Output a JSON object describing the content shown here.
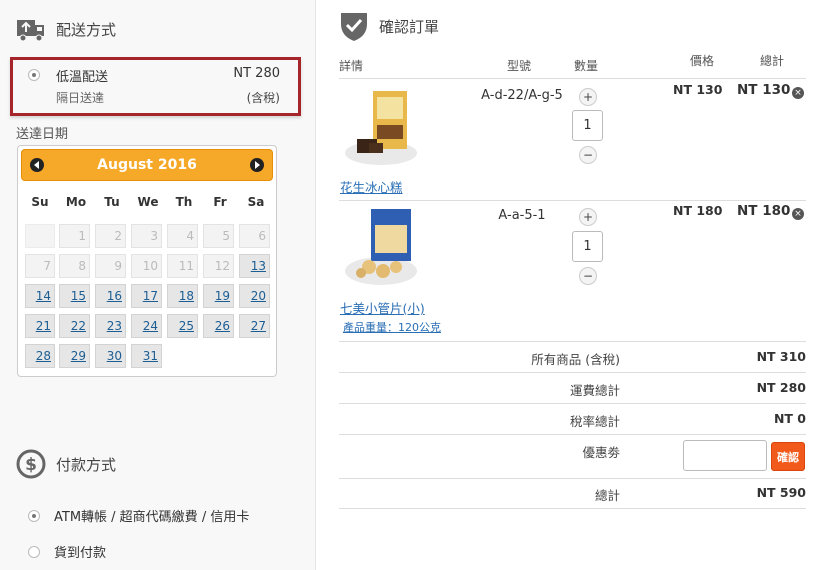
{
  "shipping": {
    "section_title": "配送方式",
    "option": {
      "name": "低溫配送",
      "price": "NT 280",
      "desc": "隔日送達",
      "tax": "(含稅)"
    },
    "date_label": "送達日期"
  },
  "calendar": {
    "month_title": "August 2016",
    "days_of_week": [
      "Su",
      "Mo",
      "Tu",
      "We",
      "Th",
      "Fr",
      "Sa"
    ],
    "rows": [
      [
        "",
        "1",
        "2",
        "3",
        "4",
        "5",
        "6"
      ],
      [
        "7",
        "8",
        "9",
        "10",
        "11",
        "12",
        "13"
      ],
      [
        "14",
        "15",
        "16",
        "17",
        "18",
        "19",
        "20"
      ],
      [
        "21",
        "22",
        "23",
        "24",
        "25",
        "26",
        "27"
      ],
      [
        "28",
        "29",
        "30",
        "31"
      ]
    ]
  },
  "payment": {
    "section_title": "付款方式",
    "options": [
      {
        "label": "ATM轉帳 / 超商代碼繳費 / 信用卡",
        "selected": true
      },
      {
        "label": "貨到付款",
        "selected": false
      }
    ]
  },
  "order": {
    "section_title": "確認訂單",
    "headers": {
      "detail": "詳情",
      "model": "型號",
      "qty": "數量",
      "price": "價格",
      "total": "總計"
    },
    "items": [
      {
        "name": "花生冰心糕",
        "model": "A-d-22/A-g-5",
        "qty": "1",
        "price": "NT 130",
        "total": "NT 130",
        "note": ""
      },
      {
        "name": "七美小管片(小)",
        "model": "A-a-5-1",
        "qty": "1",
        "price": "NT 180",
        "total": "NT 180",
        "note": "產品重量：120公克"
      }
    ],
    "summary": {
      "subtotal_label": "所有商品 (含稅)",
      "subtotal": "NT 310",
      "shipping_label": "運費總計",
      "shipping": "NT 280",
      "tax_label": "稅率總計",
      "tax": "NT 0",
      "coupon_label": "優惠劵",
      "coupon_button": "確認",
      "total_label": "總計",
      "total": "NT 590"
    },
    "qty_plus": "+",
    "qty_minus": "−",
    "remove": "×"
  }
}
